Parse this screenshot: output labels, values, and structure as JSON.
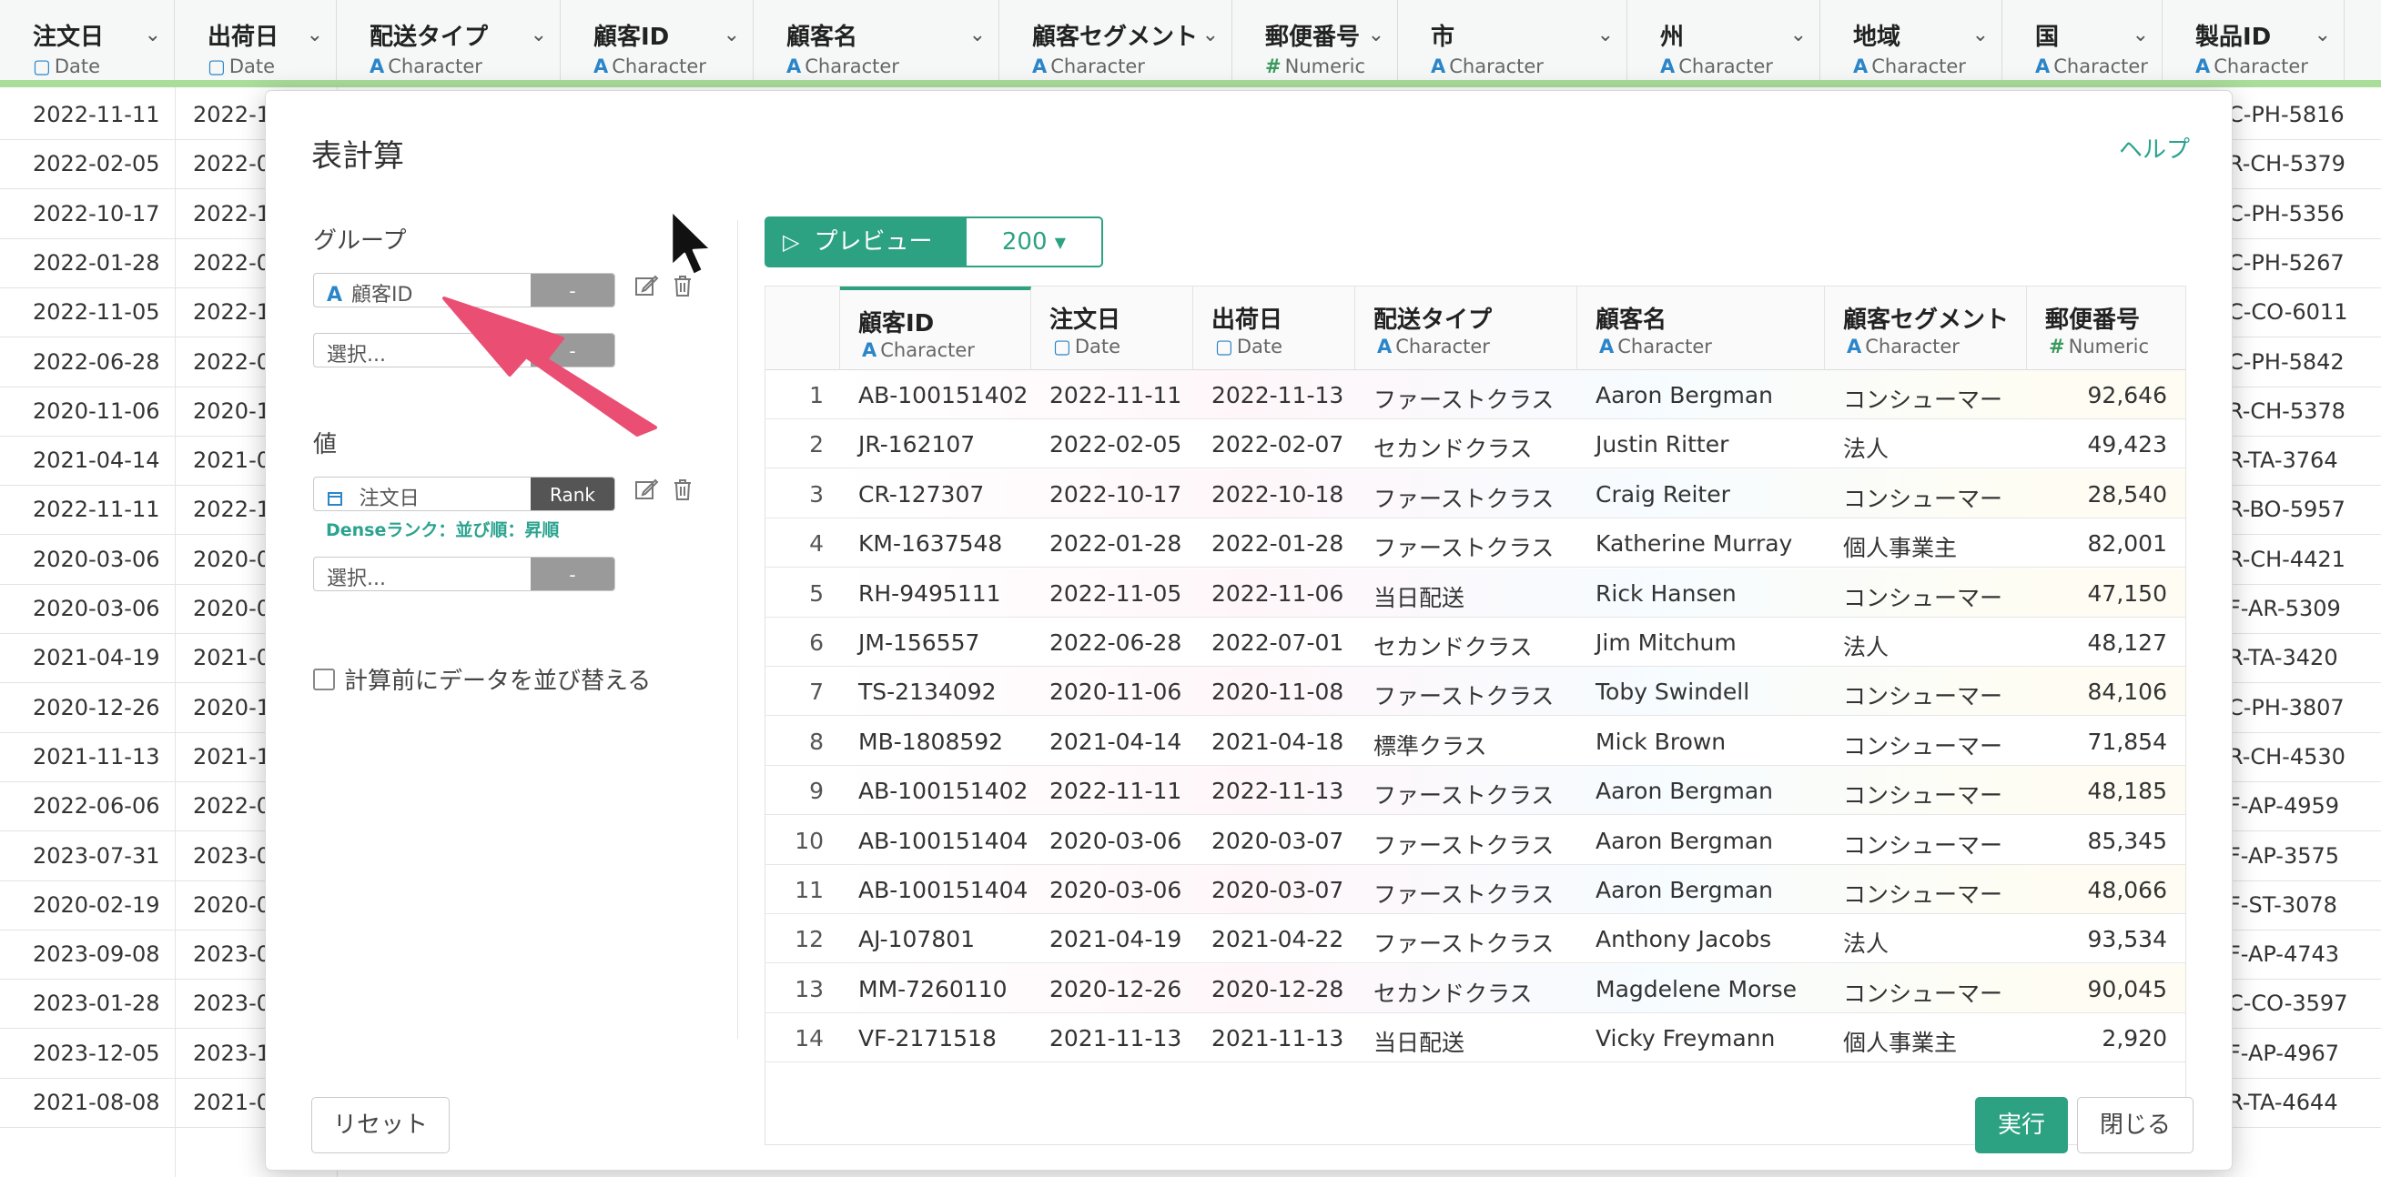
{
  "background": {
    "columns": [
      {
        "name": "注文日",
        "type": "Date",
        "type_icon": "calendar-icon"
      },
      {
        "name": "出荷日",
        "type": "Date",
        "type_icon": "calendar-icon"
      },
      {
        "name": "配送タイプ",
        "type": "Character",
        "type_icon": "A"
      },
      {
        "name": "顧客ID",
        "type": "Character",
        "type_icon": "A"
      },
      {
        "name": "顧客名",
        "type": "Character",
        "type_icon": "A"
      },
      {
        "name": "顧客セグメント",
        "type": "Character",
        "type_icon": "A"
      },
      {
        "name": "郵便番号",
        "type": "Numeric",
        "type_icon": "#"
      },
      {
        "name": "市",
        "type": "Character",
        "type_icon": "A"
      },
      {
        "name": "州",
        "type": "Character",
        "type_icon": "A"
      },
      {
        "name": "地域",
        "type": "Character",
        "type_icon": "A"
      },
      {
        "name": "国",
        "type": "Character",
        "type_icon": "A"
      },
      {
        "name": "製品ID",
        "type": "Character",
        "type_icon": "A"
      }
    ],
    "rows": [
      {
        "order_date": "2022-11-11",
        "ship_date": "2022-1",
        "product_id": "C-PH-5816"
      },
      {
        "order_date": "2022-02-05",
        "ship_date": "2022-0",
        "product_id": "R-CH-5379"
      },
      {
        "order_date": "2022-10-17",
        "ship_date": "2022-1",
        "product_id": "C-PH-5356"
      },
      {
        "order_date": "2022-01-28",
        "ship_date": "2022-0",
        "product_id": "C-PH-5267"
      },
      {
        "order_date": "2022-11-05",
        "ship_date": "2022-1",
        "product_id": "C-CO-6011"
      },
      {
        "order_date": "2022-06-28",
        "ship_date": "2022-0",
        "product_id": "C-PH-5842"
      },
      {
        "order_date": "2020-11-06",
        "ship_date": "2020-1",
        "product_id": "R-CH-5378"
      },
      {
        "order_date": "2021-04-14",
        "ship_date": "2021-0",
        "product_id": "R-TA-3764"
      },
      {
        "order_date": "2022-11-11",
        "ship_date": "2022-1",
        "product_id": "R-BO-5957"
      },
      {
        "order_date": "2020-03-06",
        "ship_date": "2020-0",
        "product_id": "R-CH-4421"
      },
      {
        "order_date": "2020-03-06",
        "ship_date": "2020-0",
        "product_id": "F-AR-5309"
      },
      {
        "order_date": "2021-04-19",
        "ship_date": "2021-0",
        "product_id": "R-TA-3420"
      },
      {
        "order_date": "2020-12-26",
        "ship_date": "2020-1",
        "product_id": "C-PH-3807"
      },
      {
        "order_date": "2021-11-13",
        "ship_date": "2021-1",
        "product_id": "R-CH-4530"
      },
      {
        "order_date": "2022-06-06",
        "ship_date": "2022-0",
        "product_id": "F-AP-4959"
      },
      {
        "order_date": "2023-07-31",
        "ship_date": "2023-0",
        "product_id": "F-AP-3575"
      },
      {
        "order_date": "2020-02-19",
        "ship_date": "2020-0",
        "product_id": "F-ST-3078"
      },
      {
        "order_date": "2023-09-08",
        "ship_date": "2023-0",
        "product_id": "F-AP-4743"
      },
      {
        "order_date": "2023-01-28",
        "ship_date": "2023-0",
        "product_id": "C-CO-3597"
      },
      {
        "order_date": "2023-12-05",
        "ship_date": "2023-1",
        "product_id": "F-AP-4967"
      },
      {
        "order_date": "2021-08-08",
        "ship_date": "2021-0",
        "product_id": "R-TA-4644"
      }
    ]
  },
  "dialog": {
    "title": "表計算",
    "help": "ヘルプ",
    "group_label": "グループ",
    "group_field": {
      "type_icon": "A",
      "value": "顧客ID",
      "button": "-"
    },
    "group_select": {
      "placeholder": "選択...",
      "button": "-"
    },
    "value_label": "値",
    "value_field": {
      "type_icon": "calendar-icon",
      "value": "注文日",
      "button": "Rank"
    },
    "value_note": "Denseランク：並び順：昇順",
    "value_select": {
      "placeholder": "選択...",
      "button": "-"
    },
    "sort_checkbox_label": "計算前にデータを並び替える",
    "sort_checked": false,
    "preview_button": "プレビュー",
    "row_count": "200",
    "reset_button": "リセット",
    "run_button": "実行",
    "close_button": "閉じる"
  },
  "preview": {
    "columns": [
      {
        "name": "顧客ID",
        "type": "Character",
        "type_icon": "A",
        "active": true
      },
      {
        "name": "注文日",
        "type": "Date",
        "type_icon": "calendar-icon"
      },
      {
        "name": "出荷日",
        "type": "Date",
        "type_icon": "calendar-icon"
      },
      {
        "name": "配送タイプ",
        "type": "Character",
        "type_icon": "A"
      },
      {
        "name": "顧客名",
        "type": "Character",
        "type_icon": "A"
      },
      {
        "name": "顧客セグメント",
        "type": "Character",
        "type_icon": "A"
      },
      {
        "name": "郵便番号",
        "type": "Numeric",
        "type_icon": "#"
      }
    ],
    "rows": [
      [
        "1",
        "AB-100151402",
        "2022-11-11",
        "2022-11-13",
        "ファーストクラス",
        "Aaron Bergman",
        "コンシューマー",
        "92,646"
      ],
      [
        "2",
        "JR-162107",
        "2022-02-05",
        "2022-02-07",
        "セカンドクラス",
        "Justin Ritter",
        "法人",
        "49,423"
      ],
      [
        "3",
        "CR-127307",
        "2022-10-17",
        "2022-10-18",
        "ファーストクラス",
        "Craig Reiter",
        "コンシューマー",
        "28,540"
      ],
      [
        "4",
        "KM-1637548",
        "2022-01-28",
        "2022-01-28",
        "ファーストクラス",
        "Katherine Murray",
        "個人事業主",
        "82,001"
      ],
      [
        "5",
        "RH-9495111",
        "2022-11-05",
        "2022-11-06",
        "当日配送",
        "Rick Hansen",
        "コンシューマー",
        "47,150"
      ],
      [
        "6",
        "JM-156557",
        "2022-06-28",
        "2022-07-01",
        "セカンドクラス",
        "Jim Mitchum",
        "法人",
        "48,127"
      ],
      [
        "7",
        "TS-2134092",
        "2020-11-06",
        "2020-11-08",
        "ファーストクラス",
        "Toby Swindell",
        "コンシューマー",
        "84,106"
      ],
      [
        "8",
        "MB-1808592",
        "2021-04-14",
        "2021-04-18",
        "標準クラス",
        "Mick Brown",
        "コンシューマー",
        "71,854"
      ],
      [
        "9",
        "AB-100151402",
        "2022-11-11",
        "2022-11-13",
        "ファーストクラス",
        "Aaron Bergman",
        "コンシューマー",
        "48,185"
      ],
      [
        "10",
        "AB-100151404",
        "2020-03-06",
        "2020-03-07",
        "ファーストクラス",
        "Aaron Bergman",
        "コンシューマー",
        "85,345"
      ],
      [
        "11",
        "AB-100151404",
        "2020-03-06",
        "2020-03-07",
        "ファーストクラス",
        "Aaron Bergman",
        "コンシューマー",
        "48,066"
      ],
      [
        "12",
        "AJ-107801",
        "2021-04-19",
        "2021-04-22",
        "ファーストクラス",
        "Anthony Jacobs",
        "法人",
        "93,534"
      ],
      [
        "13",
        "MM-7260110",
        "2020-12-26",
        "2020-12-28",
        "セカンドクラス",
        "Magdelene Morse",
        "コンシューマー",
        "90,045"
      ],
      [
        "14",
        "VF-2171518",
        "2021-11-13",
        "2021-11-13",
        "当日配送",
        "Vicky Freymann",
        "個人事業主",
        "2,920"
      ]
    ]
  },
  "colors": {
    "accent": "#2ca283",
    "arrow": "#ea4f73",
    "highlight_line": "#a9dd9a"
  }
}
